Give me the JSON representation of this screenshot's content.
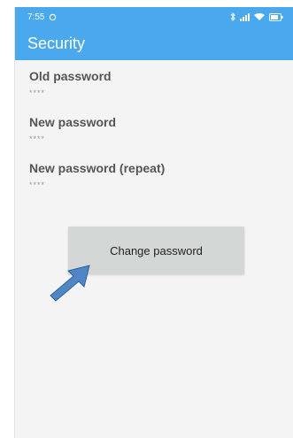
{
  "status_bar": {
    "time": "7:55",
    "left_icons": [
      "notification-icon"
    ],
    "right_icons": [
      "bluetooth-icon",
      "signal-icon",
      "wifi-icon",
      "battery-icon"
    ]
  },
  "app_bar": {
    "title": "Security"
  },
  "fields": [
    {
      "label": "Old password",
      "value": "****"
    },
    {
      "label": "New password",
      "value": "****"
    },
    {
      "label": "New password (repeat)",
      "value": "****"
    }
  ],
  "button": {
    "label": "Change password"
  },
  "colors": {
    "primary": "#4aa8ef",
    "button_bg": "#d3d8d6",
    "arrow": "#4f86c6",
    "background": "#f4f4f4"
  },
  "annotation": {
    "icon": "pointer-arrow-icon"
  }
}
